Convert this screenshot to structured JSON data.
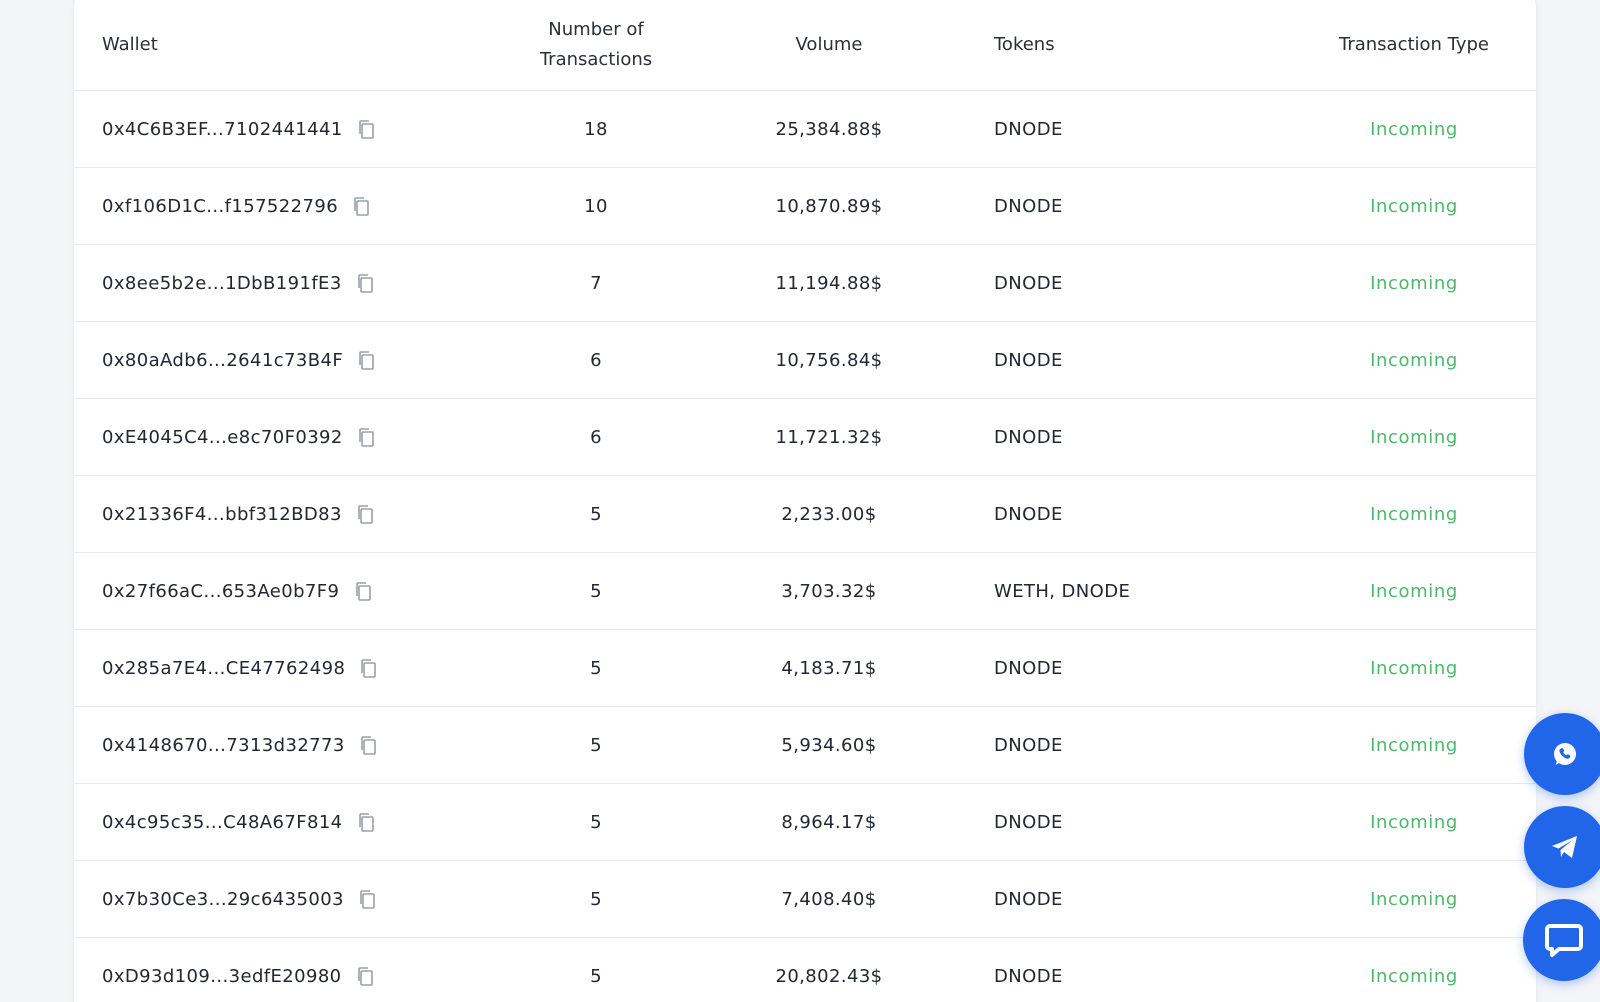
{
  "table": {
    "headers": {
      "wallet": "Wallet",
      "num_line1": "Number of",
      "num_line2": "Transactions",
      "volume": "Volume",
      "tokens": "Tokens",
      "type": "Transaction Type"
    },
    "rows": [
      {
        "wallet": "0x4C6B3EF...7102441441",
        "count": "18",
        "volume": "25,384.88$",
        "tokens": "DNODE",
        "type": "Incoming"
      },
      {
        "wallet": "0xf106D1C...f157522796",
        "count": "10",
        "volume": "10,870.89$",
        "tokens": "DNODE",
        "type": "Incoming"
      },
      {
        "wallet": "0x8ee5b2e...1DbB191fE3",
        "count": "7",
        "volume": "11,194.88$",
        "tokens": "DNODE",
        "type": "Incoming"
      },
      {
        "wallet": "0x80aAdb6...2641c73B4F",
        "count": "6",
        "volume": "10,756.84$",
        "tokens": "DNODE",
        "type": "Incoming"
      },
      {
        "wallet": "0xE4045C4...e8c70F0392",
        "count": "6",
        "volume": "11,721.32$",
        "tokens": "DNODE",
        "type": "Incoming"
      },
      {
        "wallet": "0x21336F4...bbf312BD83",
        "count": "5",
        "volume": "2,233.00$",
        "tokens": "DNODE",
        "type": "Incoming"
      },
      {
        "wallet": "0x27f66aC...653Ae0b7F9",
        "count": "5",
        "volume": "3,703.32$",
        "tokens": "WETH, DNODE",
        "type": "Incoming"
      },
      {
        "wallet": "0x285a7E4...CE47762498",
        "count": "5",
        "volume": "4,183.71$",
        "tokens": "DNODE",
        "type": "Incoming"
      },
      {
        "wallet": "0x4148670...7313d32773",
        "count": "5",
        "volume": "5,934.60$",
        "tokens": "DNODE",
        "type": "Incoming"
      },
      {
        "wallet": "0x4c95c35...C48A67F814",
        "count": "5",
        "volume": "8,964.17$",
        "tokens": "DNODE",
        "type": "Incoming"
      },
      {
        "wallet": "0x7b30Ce3...29c6435003",
        "count": "5",
        "volume": "7,408.40$",
        "tokens": "DNODE",
        "type": "Incoming"
      },
      {
        "wallet": "0xD93d109...3edfE20980",
        "count": "5",
        "volume": "20,802.43$",
        "tokens": "DNODE",
        "type": "Incoming"
      }
    ]
  },
  "icons": {
    "copy": "copy-icon",
    "whatsapp": "whatsapp-icon",
    "telegram": "telegram-icon",
    "chat": "chat-bubble-icon"
  },
  "colors": {
    "incoming": "#4cb86a",
    "float_button": "#2166e8"
  }
}
